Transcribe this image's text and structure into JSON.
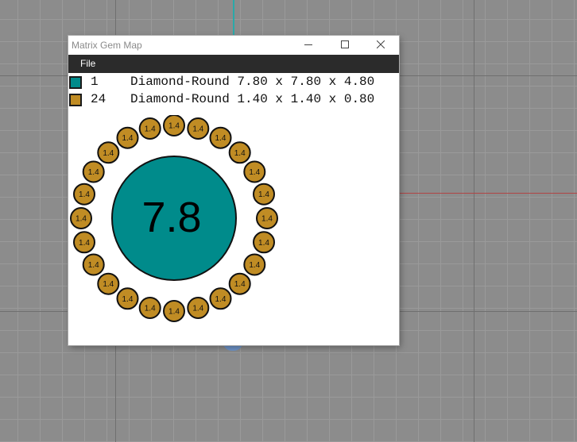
{
  "window": {
    "title": "Matrix Gem Map",
    "controls": {
      "minimize": "minimize-icon",
      "maximize": "maximize-icon",
      "close": "close-icon"
    }
  },
  "menu": {
    "file": "File"
  },
  "gems": [
    {
      "count": "1",
      "description": "Diamond-Round 7.80 x 7.80 x 4.80",
      "color": "#008b8b",
      "label": "7.8"
    },
    {
      "count": "24",
      "description": "Diamond-Round 1.40 x 1.40 x 0.80",
      "color": "#c08c24",
      "label": "1.4"
    }
  ],
  "map": {
    "center_stone_label": "7.8",
    "halo_stone_label": "1.4",
    "halo_count": 24
  }
}
